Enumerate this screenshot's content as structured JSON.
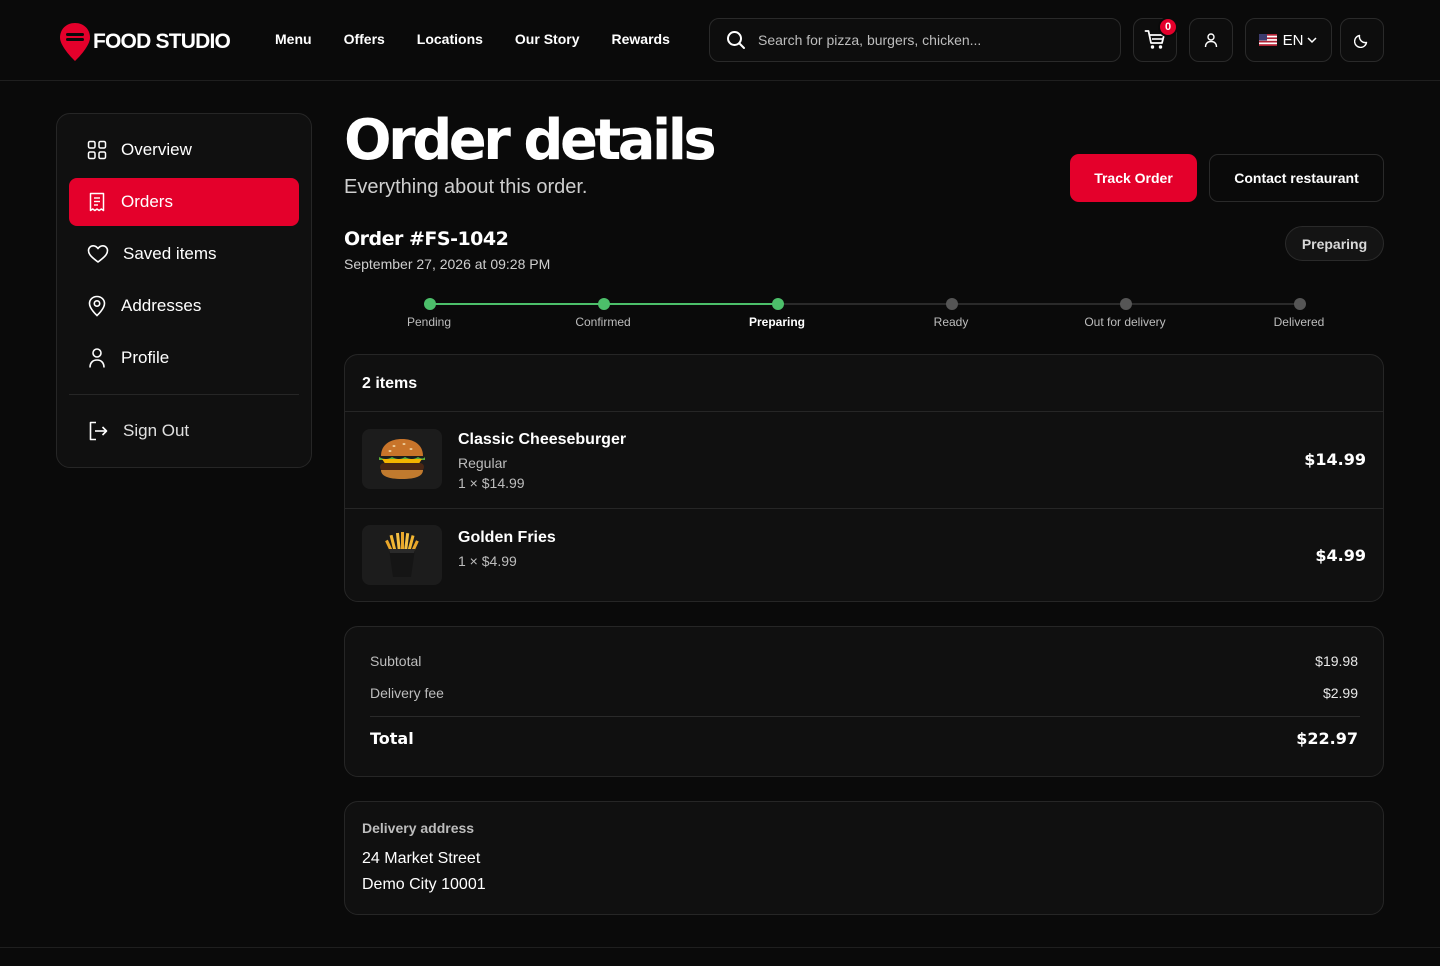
{
  "brand": {
    "name": "FOOD STUDIO",
    "accent": "#e4002b",
    "success": "#4cbf6a"
  },
  "nav": {
    "items": [
      {
        "label": "Menu"
      },
      {
        "label": "Offers"
      },
      {
        "label": "Locations"
      },
      {
        "label": "Our Story"
      },
      {
        "label": "Rewards"
      }
    ]
  },
  "header": {
    "search_placeholder": "Search for pizza, burgers, chicken...",
    "cart_count": "0",
    "language": "EN"
  },
  "sidebar": {
    "items": [
      {
        "label": "Overview",
        "icon": "grid-icon"
      },
      {
        "label": "Orders",
        "icon": "receipt-icon",
        "active": true
      },
      {
        "label": "Saved items",
        "icon": "heart-icon"
      },
      {
        "label": "Addresses",
        "icon": "map-pin-icon"
      },
      {
        "label": "Profile",
        "icon": "user-icon"
      }
    ],
    "signout": "Sign Out"
  },
  "page": {
    "title": "Order details",
    "subtitle": "Everything about this order.",
    "track_label": "Track Order",
    "contact_label": "Contact restaurant"
  },
  "order": {
    "id": "Order #FS-1042",
    "date": "September 27, 2026 at 09:28 PM",
    "status": "Preparing",
    "steps": [
      {
        "label": "Pending",
        "done": true
      },
      {
        "label": "Confirmed",
        "done": true
      },
      {
        "label": "Preparing",
        "done": true,
        "current": true
      },
      {
        "label": "Ready",
        "done": false
      },
      {
        "label": "Out for delivery",
        "done": false
      },
      {
        "label": "Delivered",
        "done": false
      }
    ],
    "items_count": "2 items",
    "items": [
      {
        "name": "Classic Cheeseburger",
        "variant": "Regular",
        "qty": "1 × $14.99",
        "price": "$14.99"
      },
      {
        "name": "Golden Fries",
        "variant": "",
        "qty": "1 × $4.99",
        "price": "$4.99"
      }
    ]
  },
  "totals": {
    "subtotal_label": "Subtotal",
    "subtotal": "$19.98",
    "delivery_label": "Delivery fee",
    "delivery": "$2.99",
    "total_label": "Total",
    "total": "$22.97"
  },
  "address": {
    "title": "Delivery address",
    "line1": "24 Market Street",
    "line2": "Demo City 10001"
  }
}
